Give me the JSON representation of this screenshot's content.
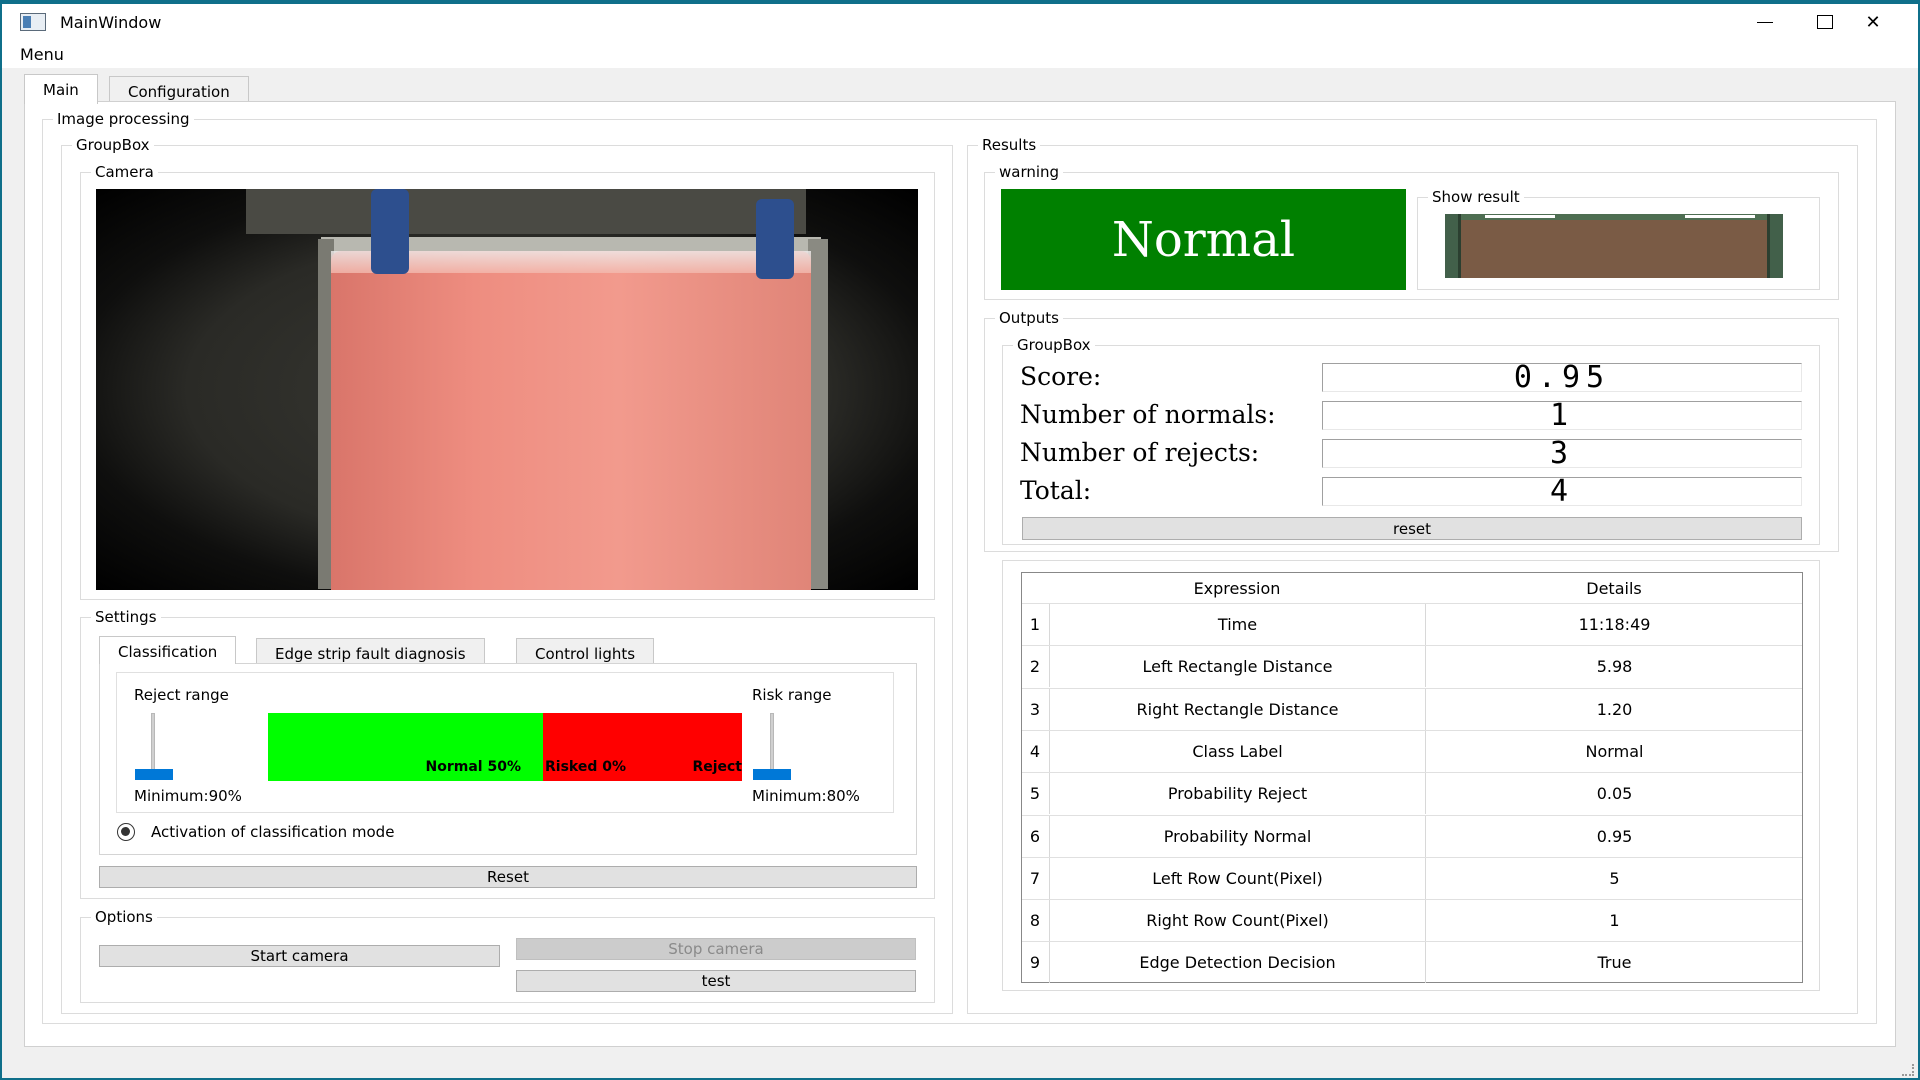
{
  "window": {
    "title": "MainWindow"
  },
  "menu": {
    "label": "Menu"
  },
  "tabs": [
    {
      "label": "Main"
    },
    {
      "label": "Configuration"
    }
  ],
  "groups": {
    "image_processing": "Image processing",
    "groupbox_left": "GroupBox",
    "camera": "Camera",
    "settings": "Settings",
    "options": "Options",
    "results": "Results",
    "warning": "warning",
    "show_result": "Show result",
    "outputs": "Outputs",
    "groupbox_outputs": "GroupBox"
  },
  "settings": {
    "tabs": [
      {
        "label": "Classification"
      },
      {
        "label": "Edge strip fault diagnosis"
      },
      {
        "label": "Control lights"
      }
    ],
    "reject_range_label": "Reject range",
    "risk_range_label": "Risk range",
    "reject_min_label": "Minimum:90%",
    "risk_min_label": "Minimum:80%",
    "bar": {
      "normal_label": "Normal 50%",
      "risked_label": "Risked 0%",
      "reject_label": "Reject",
      "normal_color": "#00ff00",
      "risk_color": "#ff0000",
      "normal_percent": 50,
      "risked_percent": 0
    },
    "activation_label": "Activation of classification mode",
    "reset_label": "Reset"
  },
  "options": {
    "start_camera": "Start camera",
    "stop_camera": "Stop camera",
    "test": "test"
  },
  "results": {
    "warning_text": "Normal",
    "warning_color": "#008000"
  },
  "outputs": {
    "score_label": "Score:",
    "score_value": "0.95",
    "normals_label": "Number of normals:",
    "normals_value": "1",
    "rejects_label": "Number of rejects:",
    "rejects_value": "3",
    "total_label": "Total:",
    "total_value": "4",
    "reset_label": "reset"
  },
  "table": {
    "headers": {
      "expression": "Expression",
      "details": "Details"
    },
    "rows": [
      {
        "num": "1",
        "expression": "Time",
        "details": "11:18:49"
      },
      {
        "num": "2",
        "expression": "Left Rectangle Distance",
        "details": "5.98"
      },
      {
        "num": "3",
        "expression": "Right Rectangle Distance",
        "details": "1.20"
      },
      {
        "num": "4",
        "expression": "Class Label",
        "details": "Normal"
      },
      {
        "num": "5",
        "expression": "Probability Reject",
        "details": "0.05"
      },
      {
        "num": "6",
        "expression": "Probability Normal",
        "details": "0.95"
      },
      {
        "num": "7",
        "expression": "Left Row Count(Pixel)",
        "details": "5"
      },
      {
        "num": "8",
        "expression": "Right Row Count(Pixel)",
        "details": "1"
      },
      {
        "num": "9",
        "expression": "Edge Detection Decision",
        "details": "True"
      }
    ]
  }
}
